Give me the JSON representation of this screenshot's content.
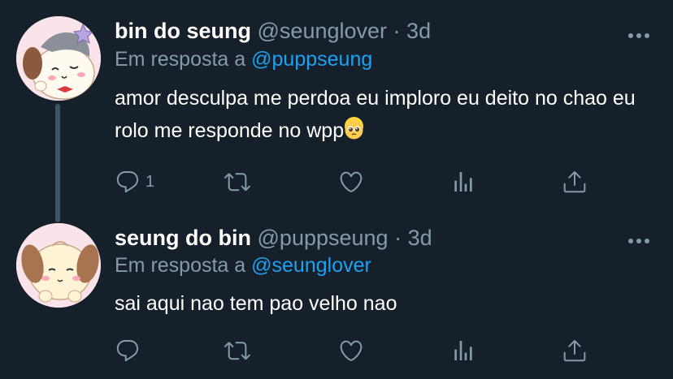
{
  "tweets": [
    {
      "author_name": "bin do seung",
      "handle": "@seunglover",
      "separator": "·",
      "time": "3d",
      "reply_prefix": "Em resposta a",
      "reply_mention": "@puppseung",
      "text": "amor desculpa me perdoa eu imploro eu deito no chao eu rolo me responde no wpp",
      "emoji": "pleading-face-emoji",
      "reply_count": "1"
    },
    {
      "author_name": "seung do bin",
      "handle": "@puppseung",
      "separator": "·",
      "time": "3d",
      "reply_prefix": "Em resposta a",
      "reply_mention": "@seunglover",
      "text": "sai aqui nao tem pao velho nao",
      "reply_count": ""
    }
  ],
  "icons": [
    "more-icon",
    "reply-icon",
    "retweet-icon",
    "like-icon",
    "analytics-icon",
    "share-icon"
  ],
  "colors": {
    "background": "#15202b",
    "text_primary": "#ffffff",
    "text_secondary": "#8899a6",
    "mention": "#1da1f2",
    "thread_line": "#3d5466"
  }
}
